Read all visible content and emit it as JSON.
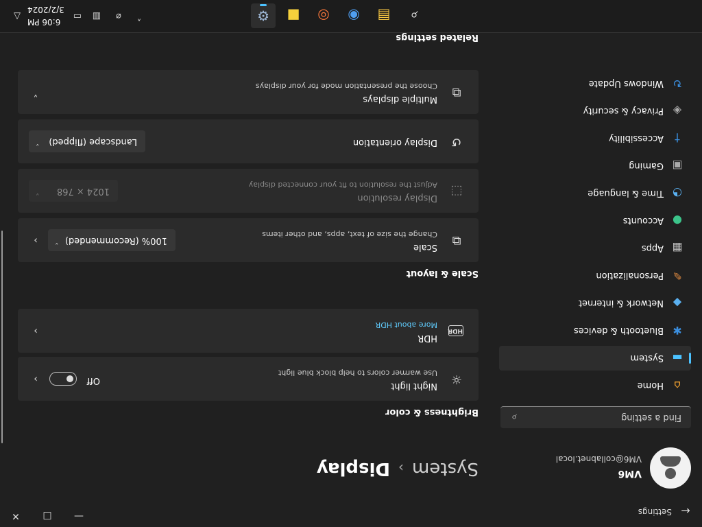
{
  "window": {
    "title": "Settings",
    "back_glyph": "←",
    "min_glyph": "—",
    "max_glyph": "□",
    "close_glyph": "✕"
  },
  "user": {
    "name": "VM6",
    "email": "VM6@collabnet.local"
  },
  "search": {
    "placeholder": "Find a setting",
    "icon": "search-icon",
    "glyph": "⌕"
  },
  "nav": {
    "items": [
      {
        "label": "Home",
        "icon": "home-icon",
        "glyph": "⌂",
        "color": "#f0a030"
      },
      {
        "label": "System",
        "icon": "system-icon",
        "glyph": "▬",
        "color": "#4cc2ff",
        "active": true
      },
      {
        "label": "Bluetooth & devices",
        "icon": "bluetooth-icon",
        "glyph": "✱",
        "color": "#3b8fe0"
      },
      {
        "label": "Network & internet",
        "icon": "network-icon",
        "glyph": "◆",
        "color": "#5ab0f0"
      },
      {
        "label": "Personalization",
        "icon": "brush-icon",
        "glyph": "✎",
        "color": "#e08a40"
      },
      {
        "label": "Apps",
        "icon": "apps-icon",
        "glyph": "▦",
        "color": "#bbbbbb"
      },
      {
        "label": "Accounts",
        "icon": "accounts-icon",
        "glyph": "●",
        "color": "#3cc48a"
      },
      {
        "label": "Time & language",
        "icon": "clock-globe-icon",
        "glyph": "◔",
        "color": "#5ab0f0"
      },
      {
        "label": "Gaming",
        "icon": "gamepad-icon",
        "glyph": "▣",
        "color": "#aaaaaa"
      },
      {
        "label": "Accessibility",
        "icon": "accessibility-icon",
        "glyph": "†",
        "color": "#3b8fe0"
      },
      {
        "label": "Privacy & security",
        "icon": "shield-icon",
        "glyph": "◈",
        "color": "#aaaaaa"
      },
      {
        "label": "Windows Update",
        "icon": "update-icon",
        "glyph": "↻",
        "color": "#3b8fe0"
      }
    ]
  },
  "breadcrumb": {
    "parent": "System",
    "separator": "›",
    "current": "Display"
  },
  "sections": {
    "brightness": "Brightness & color",
    "scale_layout": "Scale & layout",
    "related": "Related settings"
  },
  "cards": {
    "night_light": {
      "title": "Night light",
      "subtitle": "Use warmer colors to help block blue light",
      "state": "Off",
      "icon": "sun-icon",
      "glyph": "☼"
    },
    "hdr": {
      "title": "HDR",
      "link": "More about HDR",
      "icon": "hdr-icon",
      "glyph": "HDR"
    },
    "scale": {
      "title": "Scale",
      "subtitle": "Change the size of text, apps, and other items",
      "value": "100% (Recommended)",
      "icon": "scale-icon",
      "glyph": "⧉"
    },
    "resolution": {
      "title": "Display resolution",
      "subtitle": "Adjust the resolution to fit your connected display",
      "value": "1024 × 768",
      "icon": "resolution-icon",
      "glyph": "⬚",
      "disabled": true
    },
    "orientation": {
      "title": "Display orientation",
      "value": "Landscape (flipped)",
      "icon": "orientation-icon",
      "glyph": "↺"
    },
    "multiple": {
      "title": "Multiple displays",
      "subtitle": "Choose the presentation mode for your displays",
      "icon": "multiple-displays-icon",
      "glyph": "⧉"
    }
  },
  "chevrons": {
    "right": "›",
    "down": "⌄",
    "expand": "˅"
  },
  "taskbar": {
    "icons": [
      {
        "name": "search-icon",
        "glyph": "⌕"
      },
      {
        "name": "file-explorer-icon",
        "glyph": "▤"
      },
      {
        "name": "chrome-icon",
        "glyph": "◉"
      },
      {
        "name": "firefox-icon",
        "glyph": "◎"
      },
      {
        "name": "sticky-notes-icon",
        "glyph": "■"
      },
      {
        "name": "settings-gear-icon",
        "glyph": "⚙"
      }
    ],
    "tray": {
      "chevron": "˄",
      "network": "⌀",
      "volume": "▭",
      "display": "▥"
    },
    "time": "6:06 PM",
    "date": "3/2/2024",
    "bell": "△"
  },
  "colors": {
    "accent": "#4cc2ff",
    "background": "#202020",
    "card": "#2b2b2b",
    "link": "#60cdff"
  }
}
